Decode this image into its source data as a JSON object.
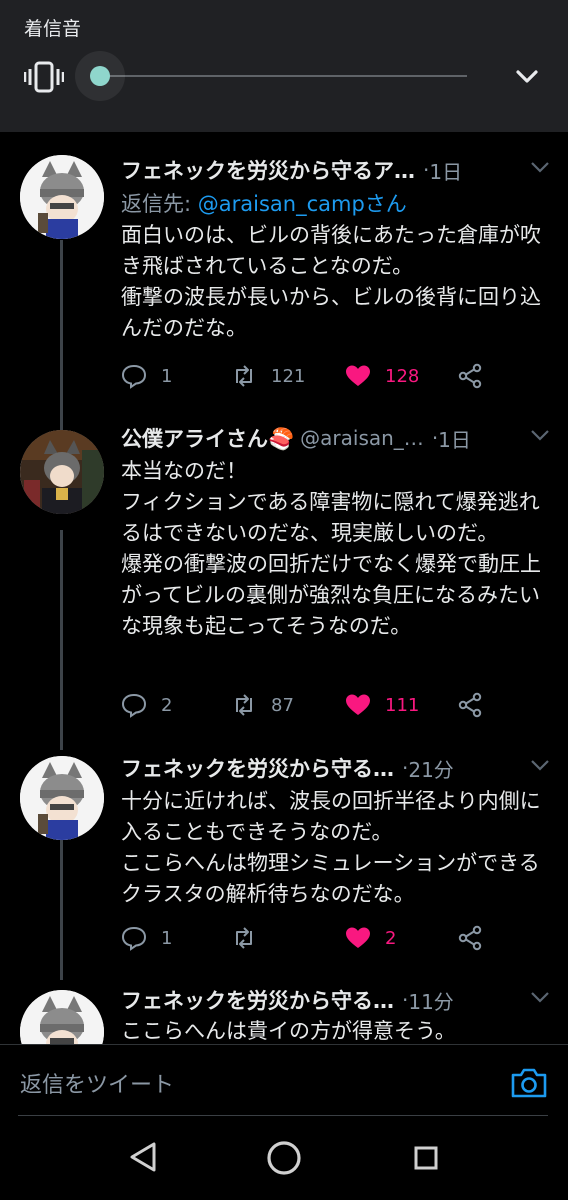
{
  "volume_panel": {
    "title": "着信音",
    "mode_icon": "vibrate-icon",
    "level_fraction": 0.0,
    "accent": "#8fd6cc"
  },
  "tweets": [
    {
      "display_name": "フェネックを労災から守るア…",
      "handle": "",
      "dot": "·",
      "time": "1日",
      "reply_to_prefix": "返信先: ",
      "reply_to_handle": "@araisan_campさん",
      "body": "面白いのは、ビルの背後にあたった倉庫が吹き飛ばされていることなのだ。\n衝撃の波長が長いから、ビルの後背に回り込んだのだな。",
      "replies": "1",
      "retweets": "121",
      "likes": "128"
    },
    {
      "display_name": "公僕アライさん🍣",
      "handle": "@araisan_…",
      "dot": "·",
      "time": "1日",
      "body": "本当なのだ！\nフィクションである障害物に隠れて爆発逃れるはできないのだな、現実厳しいのだ。\n爆発の衝撃波の回折だけでなく爆発で動圧上がってビルの裏側が強烈な負圧になるみたいな現象も起こってそうなのだ。",
      "replies": "2",
      "retweets": "87",
      "likes": "111"
    },
    {
      "display_name": "フェネックを労災から守る…",
      "handle": "",
      "dot": "·",
      "time": "21分",
      "body": "十分に近ければ、波長の回折半径より内側に入ることもできそうなのだ。\nここらへんは物理シミュレーションができるクラスタの解析待ちなのだな。",
      "replies": "1",
      "retweets": "",
      "likes": "2"
    },
    {
      "display_name": "フェネックを労災から守る…",
      "handle": "",
      "dot": "·",
      "time": "11分",
      "body": "ここらへんは貴イの方が得意そう。"
    }
  ],
  "composer": {
    "placeholder": "返信をツイート",
    "camera_icon": "camera-icon"
  },
  "colors": {
    "background": "#000000",
    "link": "#1d9bf0",
    "like": "#f91880",
    "muted": "#8b98a5"
  }
}
